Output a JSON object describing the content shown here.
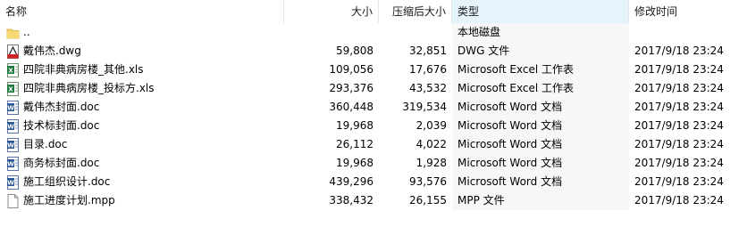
{
  "columns": {
    "name": "名称",
    "size": "大小",
    "packed": "压缩后大小",
    "type": "类型",
    "modified": "修改时间"
  },
  "rows": [
    {
      "name": "..",
      "size": "",
      "packed": "",
      "type": "本地磁盘",
      "modified": "",
      "icon": "folder-icon"
    },
    {
      "name": "戴伟杰.dwg",
      "size": "59,808",
      "packed": "32,851",
      "type": "DWG 文件",
      "modified": "2017/9/18 23:24",
      "icon": "dwg-file-icon"
    },
    {
      "name": "四院非典病房楼_其他.xls",
      "size": "109,056",
      "packed": "17,676",
      "type": "Microsoft Excel 工作表",
      "modified": "2017/9/18 23:24",
      "icon": "excel-file-icon"
    },
    {
      "name": "四院非典病房楼_投标方.xls",
      "size": "293,376",
      "packed": "43,532",
      "type": "Microsoft Excel 工作表",
      "modified": "2017/9/18 23:24",
      "icon": "excel-file-icon"
    },
    {
      "name": "戴伟杰封面.doc",
      "size": "360,448",
      "packed": "319,534",
      "type": "Microsoft Word 文档",
      "modified": "2017/9/18 23:24",
      "icon": "word-file-icon"
    },
    {
      "name": "技术标封面.doc",
      "size": "19,968",
      "packed": "2,039",
      "type": "Microsoft Word 文档",
      "modified": "2017/9/18 23:24",
      "icon": "word-file-icon"
    },
    {
      "name": "目录.doc",
      "size": "26,112",
      "packed": "4,022",
      "type": "Microsoft Word 文档",
      "modified": "2017/9/18 23:24",
      "icon": "word-file-icon"
    },
    {
      "name": "商务标封面.doc",
      "size": "19,968",
      "packed": "1,928",
      "type": "Microsoft Word 文档",
      "modified": "2017/9/18 23:24",
      "icon": "word-file-icon"
    },
    {
      "name": "施工组织设计.doc",
      "size": "439,296",
      "packed": "93,576",
      "type": "Microsoft Word 文档",
      "modified": "2017/9/18 23:24",
      "icon": "word-file-icon"
    },
    {
      "name": "施工进度计划.mpp",
      "size": "338,432",
      "packed": "26,155",
      "type": "MPP 文件",
      "modified": "2017/9/18 23:24",
      "icon": "generic-file-icon"
    }
  ]
}
